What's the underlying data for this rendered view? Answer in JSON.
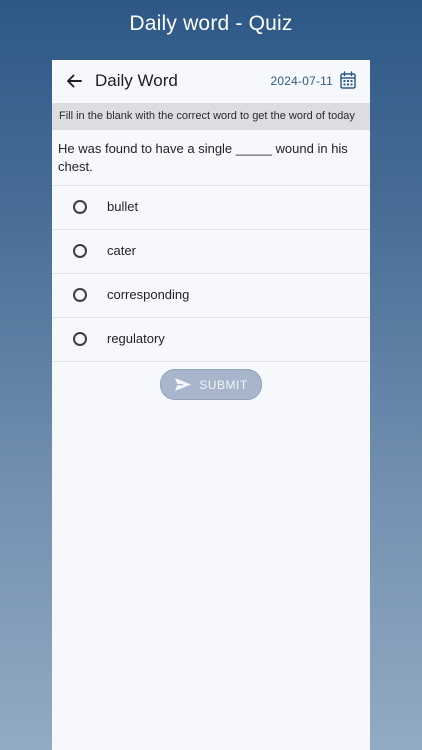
{
  "app": {
    "title": "Daily word - Quiz"
  },
  "header": {
    "title": "Daily Word",
    "date": "2024-07-11"
  },
  "quiz": {
    "instruction": "Fill in the blank with the correct word to get the word of today",
    "question": "He was found to have a single _____ wound in his chest.",
    "options": [
      {
        "label": "bullet",
        "selected": false
      },
      {
        "label": "cater",
        "selected": false
      },
      {
        "label": "corresponding",
        "selected": false
      },
      {
        "label": "regulatory",
        "selected": false
      }
    ],
    "submit_label": "SUBMIT",
    "submit_enabled": false
  },
  "icons": {
    "back": "arrow-left-icon",
    "calendar": "calendar-icon",
    "submit": "send-icon"
  },
  "colors": {
    "accent": "#2f5a86",
    "submit_disabled_bg": "#a7b6cb",
    "card_bg": "#f7f8fc",
    "instruction_bg": "#dddde1"
  }
}
